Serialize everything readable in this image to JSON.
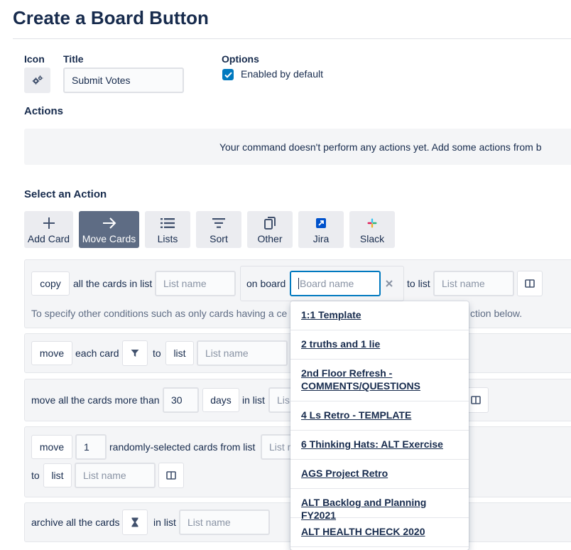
{
  "page": {
    "title": "Create a Board Button"
  },
  "form": {
    "icon_label": "Icon",
    "title_label": "Title",
    "title_value": "Submit Votes",
    "options_label": "Options",
    "enabled_label": "Enabled by default",
    "enabled_checked": true
  },
  "actions": {
    "heading": "Actions",
    "empty_text": "Your command doesn't perform any actions yet. Add some actions from b"
  },
  "select_action": {
    "heading": "Select an Action",
    "tabs": [
      {
        "label": "Add Card",
        "icon": "plus-icon",
        "active": false
      },
      {
        "label": "Move Cards",
        "icon": "arrow-right-icon",
        "active": true
      },
      {
        "label": "Lists",
        "icon": "list-icon",
        "active": false
      },
      {
        "label": "Sort",
        "icon": "sort-icon",
        "active": false
      },
      {
        "label": "Other",
        "icon": "copy-icon",
        "active": false
      },
      {
        "label": "Jira",
        "icon": "jira-icon",
        "active": false
      },
      {
        "label": "Slack",
        "icon": "slack-icon",
        "active": false
      }
    ]
  },
  "rows": {
    "copy": {
      "verb": "copy",
      "text1": "all the cards in list",
      "list_placeholder": "List name",
      "on_board": "on board",
      "board_placeholder": "Board name",
      "to_list": "to list",
      "to_list_placeholder": "List name",
      "hint_left": "To specify other conditions such as only cards having a ce",
      "hint_right": "ction below."
    },
    "move_each": {
      "verb": "move",
      "text1": "each card",
      "to": "to",
      "list_sel": "list",
      "list_placeholder": "List name"
    },
    "move_older": {
      "text1": "move all the cards more than",
      "days_value": "30",
      "days_sel": "days",
      "in_list": "in list",
      "list_partial": "Lis"
    },
    "move_random": {
      "verb": "move",
      "count": "1",
      "text1": "randomly-selected cards from list",
      "list_partial": "List n",
      "to": "to",
      "list_sel": "list",
      "list_placeholder": "List name"
    },
    "archive": {
      "text1": "archive all the cards",
      "in_list": "in list",
      "list_placeholder": "List name"
    }
  },
  "board_dropdown": {
    "items": [
      "1:1 Template",
      "2 truths and 1 lie",
      "2nd Floor Refresh - COMMENTS/QUESTIONS",
      "4 Ls Retro - TEMPLATE",
      "6 Thinking Hats: ALT Exercise",
      "AGS Project Retro",
      "ALT Backlog and Planning FY2021",
      "ALT HEALTH CHECK 2020"
    ]
  },
  "colors": {
    "accent": "#0079bf",
    "active_tab": "#5e6c84",
    "text": "#172b4d"
  }
}
